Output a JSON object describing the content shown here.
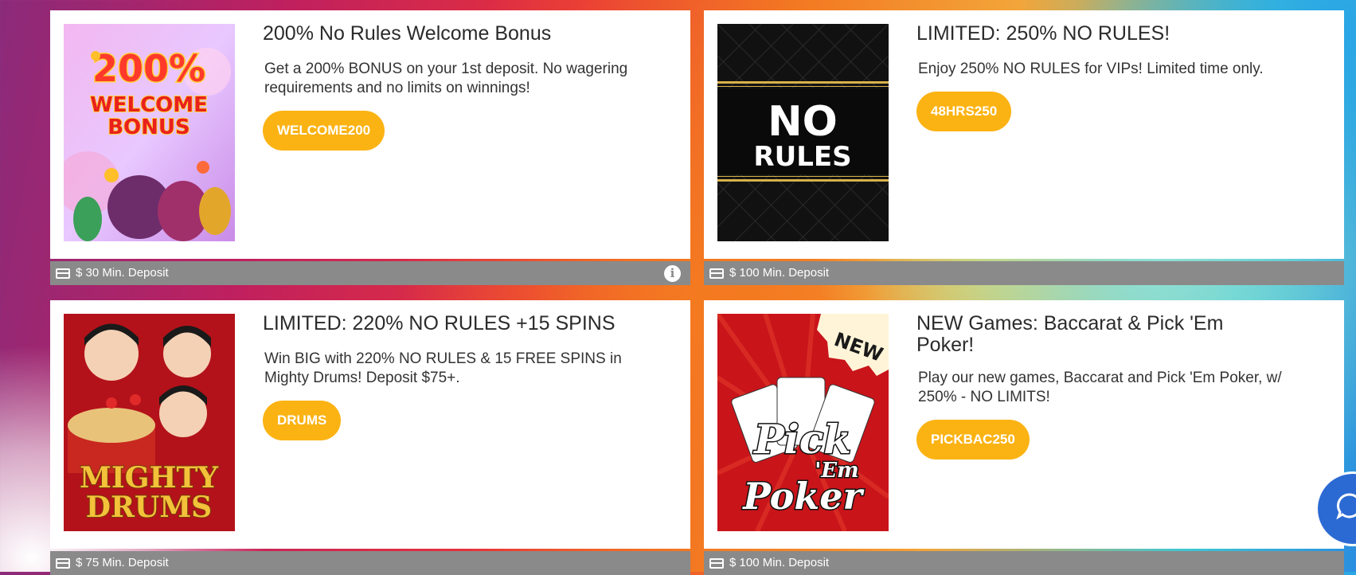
{
  "promos": [
    {
      "title": "200% No Rules Welcome Bonus",
      "description": "Get a 200% BONUS on your 1st deposit. No wagering requirements and no limits on winnings!",
      "code": "WELCOME200",
      "min_deposit": "$ 30 Min. Deposit",
      "thumb": {
        "line1": "200%",
        "line2": "WELCOME",
        "line3": "BONUS"
      }
    },
    {
      "title": "LIMITED: 250% NO RULES!",
      "description": "Enjoy 250% NO RULES for VIPs! Limited time only.",
      "code": "48HRS250",
      "min_deposit": "$ 100 Min. Deposit",
      "thumb": {
        "line1": "NO",
        "line2": "RULES"
      }
    },
    {
      "title": "LIMITED: 220% NO RULES +15 SPINS",
      "description": "Win BIG with 220% NO RULES & 15 FREE SPINS in Mighty Drums! Deposit $75+.",
      "code": "DRUMS",
      "min_deposit": "$ 75 Min. Deposit",
      "thumb": {
        "line1": "MIGHTY",
        "line2": "DRUMS"
      }
    },
    {
      "title": "NEW Games: Baccarat & Pick 'Em Poker!",
      "description": "Play our new games, Baccarat and Pick 'Em Poker, w/ 250% - NO LIMITS!",
      "code": "PICKBAC250",
      "min_deposit": "$ 100 Min. Deposit",
      "thumb": {
        "badge": "NEW",
        "line1": "Pick",
        "line2": "'Em",
        "line3": "Poker"
      }
    }
  ],
  "icons": {
    "card": "credit-card-icon",
    "info": "info-icon",
    "info_glyph": "i",
    "chat": "chat-bubble-icon"
  },
  "colors": {
    "button": "#fbb313",
    "bar": "#8a8a8a",
    "chat": "#2c6ad3"
  }
}
